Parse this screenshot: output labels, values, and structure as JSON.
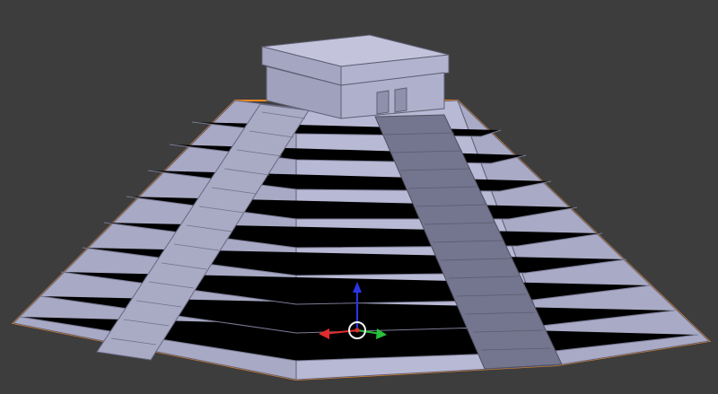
{
  "viewport": {
    "background_color": "#3d3d3d",
    "selection_outline_color": "#f08a24"
  },
  "object": {
    "name": "stepped-pyramid",
    "terrace_count": 9,
    "colors": {
      "face_light": "#b8b9d4",
      "face_mid": "#a3a4c0",
      "face_dark": "#8e8fab",
      "stair_dark": "#6e6f87",
      "edge": "#5f6075"
    }
  },
  "gizmo": {
    "axes": [
      {
        "name": "z",
        "color": "#2b35e6"
      },
      {
        "name": "x",
        "color": "#e02c2c"
      },
      {
        "name": "y",
        "color": "#27c13a"
      }
    ],
    "center_color": "#f2f2f2"
  }
}
